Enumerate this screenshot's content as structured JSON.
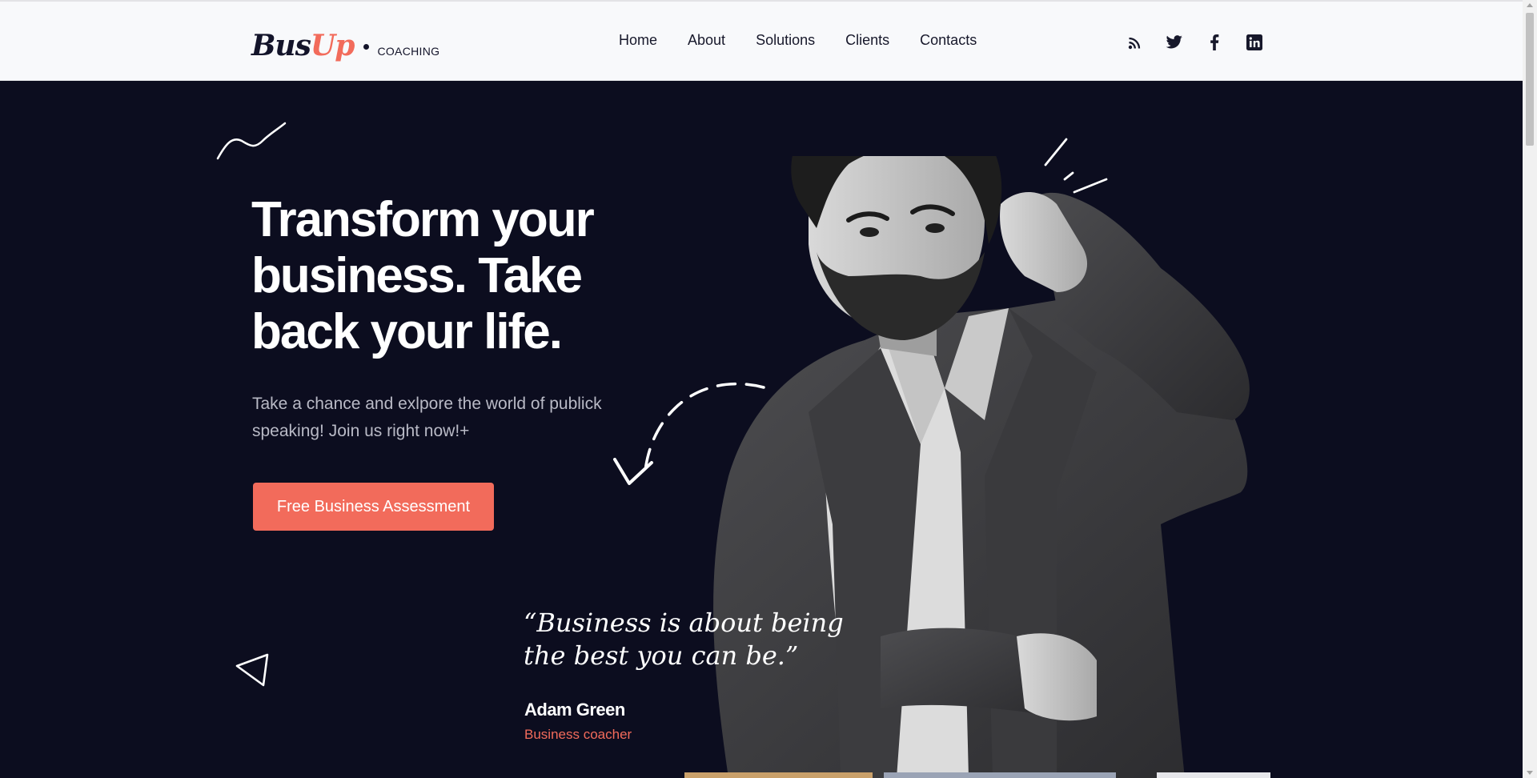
{
  "brand": {
    "name_part1": "Bus",
    "name_part2": "Up",
    "tagline": "COACHING"
  },
  "nav": {
    "items": [
      "Home",
      "About",
      "Solutions",
      "Clients",
      "Contacts"
    ]
  },
  "social": [
    "rss-icon",
    "twitter-icon",
    "facebook-icon",
    "linkedin-icon"
  ],
  "hero": {
    "title": "Transform your business. Take back your life.",
    "subtitle": "Take a chance and exlpore the world of publick speaking! Join us right now!+",
    "cta_label": "Free Business Assessment"
  },
  "quote": {
    "text": "“Business is about being the best you can be.”",
    "author": "Adam Green",
    "role": "Business coacher"
  },
  "colors": {
    "accent": "#f26b5b",
    "background": "#0c0d1f",
    "header_bg": "#f8f9fb",
    "text_dark": "#17182b"
  }
}
